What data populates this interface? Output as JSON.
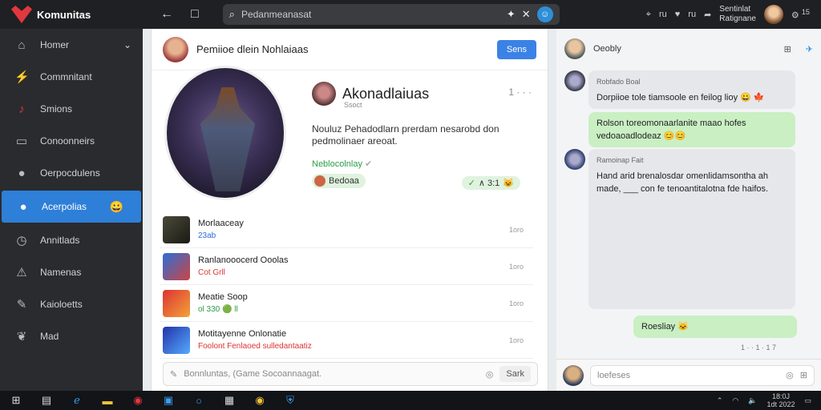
{
  "app": {
    "title": "Komunitas"
  },
  "topnav": {
    "back": "←",
    "square": "□"
  },
  "search": {
    "placeholder": "Pedanmeanasat"
  },
  "topright": {
    "item1": "ru",
    "item2": "ru",
    "user_line1": "Sentinlat",
    "user_line2": "Ratignane",
    "notif_count": "15"
  },
  "sidebar": {
    "items": [
      {
        "label": "Homer",
        "icon": "home-icon"
      },
      {
        "label": "Commnitant",
        "icon": "lightning-icon"
      },
      {
        "label": "Smions",
        "icon": "music-icon"
      },
      {
        "label": "Conoonneirs",
        "icon": "window-icon"
      },
      {
        "label": "Oerpocdulens",
        "icon": "avatar-icon"
      },
      {
        "label": "Acerpolias",
        "icon": "avatar-icon",
        "badge": "😀"
      },
      {
        "label": "Annitlads",
        "icon": "clock-icon"
      },
      {
        "label": "Namenas",
        "icon": "warning-icon"
      },
      {
        "label": "Kaioloetts",
        "icon": "brush-icon"
      },
      {
        "label": "Mad",
        "icon": "leaf-icon"
      }
    ]
  },
  "main": {
    "header_title": "Pemiioe dlein Nohlaiaas",
    "header_button": "Sens",
    "profile": {
      "name": "Akonadlaiuas",
      "sub": "Ssoct",
      "dots": "1 · · ·",
      "description": "Nouluz Pehadodlarn prerdam nesarobd don pedmolinaer areoat.",
      "status": "Neblocolnlay",
      "tag_left": "Bedoaa",
      "tag_right": "∧ 3:1",
      "tag_right_count": "✓"
    },
    "list": [
      {
        "name": "Morlaaceay",
        "meta": "23ab",
        "time": "1oro"
      },
      {
        "name": "Ranlanooocerd Ooolas",
        "meta": "Cot Grll",
        "time": "1oro"
      },
      {
        "name": "Meatie Soop",
        "meta": "ol 330 🟢 ll",
        "time": "1oro"
      },
      {
        "name": "Motitayenne Onlonatie",
        "meta": "Foolont Fenlaoed sulledantaatiz",
        "time": "1oro"
      }
    ],
    "composer": {
      "placeholder": "Bonnluntas, (Game Socoannaagat.",
      "send": "Sark"
    }
  },
  "chat": {
    "title": "Oeobly",
    "messages": [
      {
        "sender": "Robfado Boal",
        "text": "Dorpiioe tole tiamsoole en feilog lioy 😀 🍁"
      },
      {
        "sender": "",
        "text": "Rolson toreomonaarlanite maao hofes vedoaoadlodeaz 😊😊"
      },
      {
        "sender": "Ramoinap Fait",
        "text": "Hand arid brenalosdar omenlidamsontha ah made, ___ con fe tenoantitalotna fde haifos."
      },
      {
        "sender": "",
        "text": "Roesliay 🐱"
      }
    ],
    "read_marks": "1 · · 1 · 1 7",
    "input_placeholder": "loefeses"
  },
  "taskbar": {
    "time": "18:0J",
    "date": "1dt 2022"
  },
  "colors": {
    "accent": "#2e7fd8",
    "bubble_green": "#c9efc3",
    "bubble_gray": "#e6e7ea",
    "brand_red": "#e0383e"
  }
}
